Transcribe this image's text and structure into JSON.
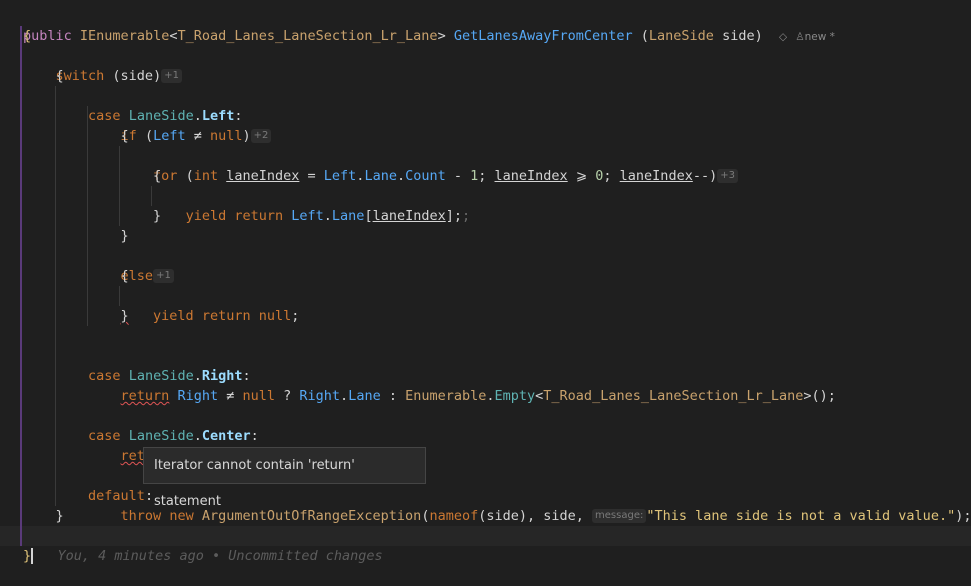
{
  "method": {
    "modifier": "public",
    "return_type": "IEnumerable",
    "generic_type": "T_Road_Lanes_LaneSection_Lr_Lane",
    "name": "GetLanesAwayFromCenter",
    "param_type": "LaneSide",
    "param_name": "side",
    "meta_icon": "diamond-icon",
    "meta_label": "new *"
  },
  "hints": {
    "switch": "+1",
    "if": "+2",
    "for": "+3",
    "else": "+1",
    "message": "message:"
  },
  "tooltip": {
    "text": "Iterator cannot contain 'return' statement"
  },
  "blame": {
    "text": "You, 4 minutes ago • Uncommitted changes"
  }
}
